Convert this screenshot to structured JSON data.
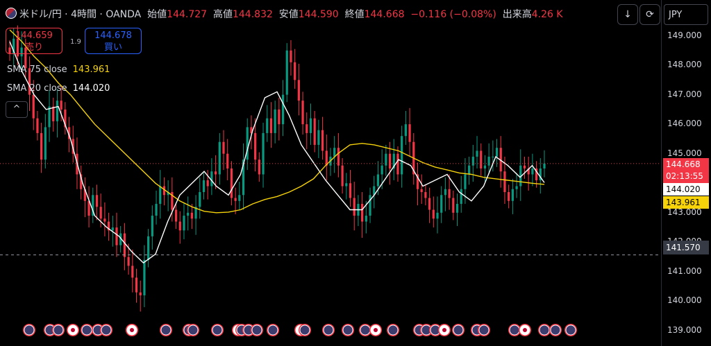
{
  "header": {
    "symbol": "米ドル/円 · 4時間 · OANDA",
    "open_label": "始値",
    "open": "144.727",
    "high_label": "高値",
    "high": "144.832",
    "low_label": "安値",
    "low": "144.590",
    "close_label": "終値",
    "close": "144.668",
    "change": "−0.116 (−0.08%)",
    "volume_label": "出来高",
    "volume": "4.26 K"
  },
  "trade": {
    "sell_price": "144.659",
    "sell_label": "売り",
    "buy_price": "144.678",
    "buy_label": "買い",
    "spread": "1.9"
  },
  "indicators": [
    {
      "label": "SMA 75 close",
      "value": "143.961",
      "color": "#f5d20a"
    },
    {
      "label": "SMA 20 close",
      "value": "144.020",
      "color": "#ffffff"
    }
  ],
  "toolbar": {
    "collapse": "^",
    "down_icon": "↓",
    "refresh_icon": "⟳",
    "currency": "JPY"
  },
  "colors": {
    "up": "#089981",
    "down": "#f23645",
    "sma75": "#f5d20a",
    "sma20": "#ffffff",
    "buy": "#2962ff"
  },
  "axis_tags": {
    "last_price": "144.668",
    "countdown": "02:13:55",
    "sma20": "144.020",
    "sma75": "143.961",
    "crosshair": "141.570"
  },
  "chart_data": {
    "type": "candlestick",
    "ylim": [
      138.6,
      149.6
    ],
    "yticks": [
      "139.000",
      "140.000",
      "141.000",
      "142.000",
      "143.000",
      "144.000",
      "145.000",
      "146.000",
      "147.000",
      "148.000",
      "149.000"
    ],
    "grid": false,
    "crosshair_y": 141.57,
    "last_price": 144.668,
    "close_path": [
      148.4,
      148.9,
      148.3,
      148.6,
      147.9,
      147.0,
      146.2,
      145.7,
      144.8,
      145.9,
      146.6,
      146.1,
      146.8,
      146.5,
      145.9,
      145.5,
      145.0,
      144.3,
      143.8,
      143.4,
      142.9,
      143.6,
      143.2,
      142.8,
      142.7,
      142.4,
      142.5,
      141.9,
      142.3,
      141.5,
      141.2,
      140.8,
      140.3,
      140.2,
      141.4,
      142.2,
      142.9,
      143.3,
      143.9,
      143.6,
      143.7,
      143.1,
      142.7,
      142.4,
      142.9,
      143.0,
      142.8,
      143.2,
      143.7,
      144.1,
      143.9,
      144.4,
      144.3,
      145.4,
      145.0,
      144.5,
      143.5,
      143.4,
      143.6,
      144.8,
      145.9,
      145.7,
      144.8,
      144.3,
      145.7,
      146.2,
      145.7,
      146.5,
      146.0,
      147.0,
      148.5,
      148.1,
      147.5,
      146.8,
      146.0,
      145.7,
      146.2,
      145.3,
      145.8,
      145.1,
      144.6,
      144.9,
      145.2,
      144.6,
      143.9,
      144.0,
      143.5,
      142.9,
      143.3,
      142.7,
      142.9,
      143.6,
      143.9,
      144.3,
      144.6,
      145.0,
      144.5,
      145.0,
      144.3,
      145.6,
      146.0,
      145.4,
      144.3,
      143.8,
      143.7,
      143.5,
      143.1,
      142.8,
      143.0,
      143.6,
      143.8,
      143.5,
      143.0,
      143.3,
      143.8,
      144.3,
      144.6,
      144.9,
      145.1,
      144.5,
      144.6,
      144.9,
      144.9,
      145.2,
      144.4,
      143.7,
      143.4,
      143.8,
      143.9,
      144.6,
      144.5,
      144.3,
      144.5,
      144.1,
      144.5,
      144.668
    ],
    "sma75": [
      149.2,
      148.8,
      148.3,
      147.9,
      147.4,
      147.0,
      146.5,
      146.0,
      145.6,
      145.2,
      144.8,
      144.4,
      144.0,
      143.7,
      143.4,
      143.2,
      143.05,
      143.0,
      143.02,
      143.1,
      143.3,
      143.45,
      143.55,
      143.7,
      143.9,
      144.15,
      144.6,
      145.0,
      145.3,
      145.35,
      145.3,
      145.2,
      145.1,
      144.9,
      144.7,
      144.55,
      144.45,
      144.35,
      144.3,
      144.2,
      144.15,
      144.1,
      144.05,
      144.0,
      143.961
    ],
    "sma20": [
      148.8,
      147.8,
      147.0,
      146.5,
      146.6,
      145.5,
      144.0,
      142.9,
      142.5,
      142.2,
      141.7,
      141.3,
      141.6,
      142.7,
      143.6,
      144.0,
      144.4,
      143.9,
      143.6,
      144.3,
      145.8,
      146.9,
      147.1,
      146.3,
      145.3,
      144.7,
      144.1,
      143.6,
      143.1,
      143.1,
      143.6,
      144.2,
      144.8,
      144.6,
      143.9,
      144.1,
      144.3,
      143.7,
      143.4,
      143.9,
      144.9,
      144.6,
      144.2,
      144.6,
      144.02
    ],
    "event_marker_clusters": [
      42,
      72,
      84,
      105,
      125,
      141,
      153,
      190,
      190,
      239,
      272,
      278,
      313,
      343,
      348,
      358,
      370,
      393,
      433,
      439,
      473,
      501,
      526,
      541,
      566,
      604,
      614,
      627,
      640,
      660,
      687,
      697,
      741,
      756,
      784,
      800,
      822
    ]
  }
}
